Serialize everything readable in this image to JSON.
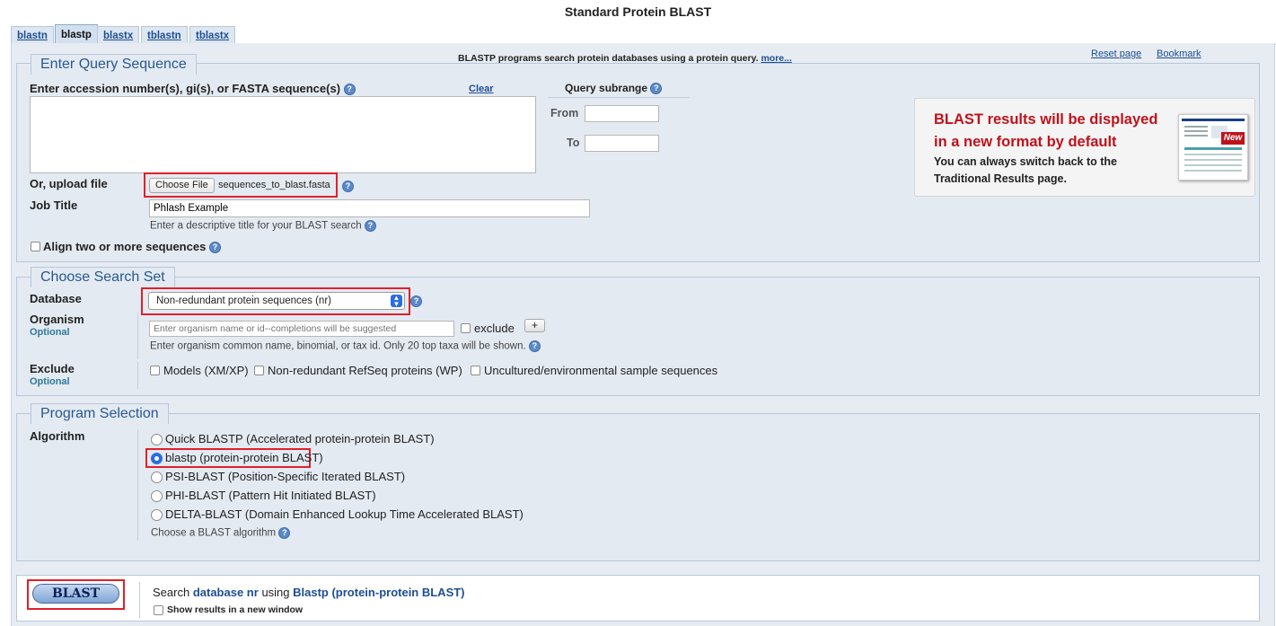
{
  "page_title": "Standard Protein BLAST",
  "tabs": [
    "blastn",
    "blastp",
    "blastx",
    "tblastn",
    "tblastx"
  ],
  "active_tab": "blastp",
  "header": {
    "description": "BLASTP programs search protein databases using a protein query.",
    "more_link": "more...",
    "reset_page": "Reset page",
    "bookmark": "Bookmark"
  },
  "query": {
    "legend": "Enter Query Sequence",
    "sequence_label": "Enter accession number(s), gi(s), or FASTA sequence(s)",
    "clear": "Clear",
    "sequence_value": "",
    "subrange_label": "Query subrange",
    "from_label": "From",
    "to_label": "To",
    "upload_label": "Or, upload file",
    "choose_file": "Choose File",
    "file_name": "sequences_to_blast.fasta",
    "job_title_label": "Job Title",
    "job_title_value": "Phlash Example",
    "job_title_hint": "Enter a descriptive title for your BLAST search",
    "align_two": "Align two or more sequences"
  },
  "notice": {
    "title_line1": "BLAST results will be displayed",
    "title_line2": "in a new format by default",
    "sub_line1": "You can always switch back to the",
    "sub_line2": "Traditional Results page.",
    "badge": "New"
  },
  "search_set": {
    "legend": "Choose Search Set",
    "database_label": "Database",
    "database_value": "Non-redundant protein sequences (nr)",
    "organism_label": "Organism",
    "optional": "Optional",
    "organism_placeholder": "Enter organism name or id--completions will be suggested",
    "exclude_label": "exclude",
    "plus": "+",
    "organism_hint": "Enter organism common name, binomial, or tax id. Only 20 top taxa will be shown.",
    "exclude_section_label": "Exclude",
    "exclude_opts": [
      "Models (XM/XP)",
      "Non-redundant RefSeq proteins (WP)",
      "Uncultured/environmental sample sequences"
    ]
  },
  "program": {
    "legend": "Program Selection",
    "algorithm_label": "Algorithm",
    "options": [
      "Quick BLASTP (Accelerated protein-protein BLAST)",
      "blastp (protein-protein BLAST)",
      "PSI-BLAST (Position-Specific Iterated BLAST)",
      "PHI-BLAST (Pattern Hit Initiated BLAST)",
      "DELTA-BLAST (Domain Enhanced Lookup Time Accelerated BLAST)"
    ],
    "selected": "blastp (protein-protein BLAST)",
    "hint": "Choose a BLAST algorithm"
  },
  "submit": {
    "button": "BLAST",
    "search_prefix": "Search",
    "database_text": "database nr",
    "using": "using",
    "program_text": "Blastp (protein-protein BLAST)",
    "new_window": "Show results in a new window"
  }
}
